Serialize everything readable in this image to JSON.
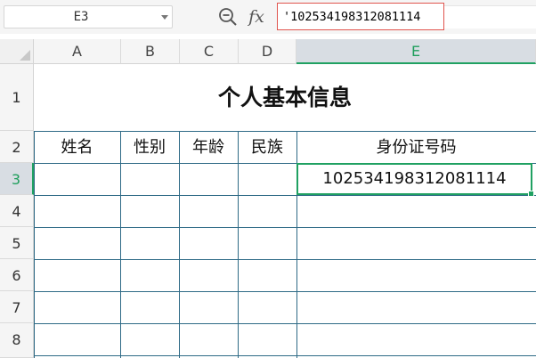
{
  "formula_bar": {
    "name_box": "E3",
    "fx_label": "fx",
    "formula_value": "'102534198312081114"
  },
  "columns": [
    "A",
    "B",
    "C",
    "D",
    "E"
  ],
  "rows": [
    "1",
    "2",
    "3",
    "4",
    "5",
    "6",
    "7",
    "8"
  ],
  "active_cell": {
    "column": "E",
    "row": "3"
  },
  "sheet": {
    "title": "个人基本信息",
    "headers": [
      "姓名",
      "性别",
      "年龄",
      "民族",
      "身份证号码"
    ],
    "e3_value": "102534198312081114"
  },
  "colors": {
    "selection": "#20a162",
    "formula_border": "#e0544e",
    "gridline": "#2e6a86"
  },
  "icons": [
    "zoom-in-icon",
    "dropdown-caret-icon",
    "select-all-triangle-icon"
  ]
}
